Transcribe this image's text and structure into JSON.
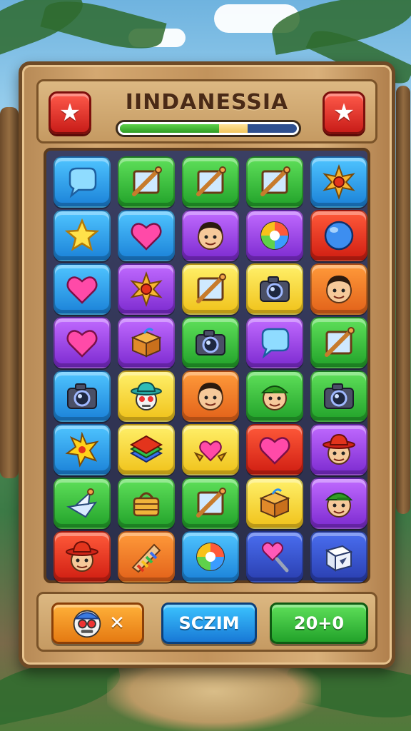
{
  "header": {
    "title": "IINDANESSIA",
    "left_icon": "star-icon",
    "right_icon": "star-icon",
    "progress": {
      "green_fraction": 0.56,
      "yellow_fraction": 0.16,
      "navy_fraction": 0.28,
      "colors": {
        "green": "#3fb22e",
        "yellow": "#f2c45c",
        "navy": "#2f4f8f"
      }
    }
  },
  "board": {
    "rows": 8,
    "cols": 5,
    "tiles": [
      [
        {
          "color": "blue",
          "icon": "chat-bubble-icon"
        },
        {
          "color": "green",
          "icon": "ruler-frame-icon"
        },
        {
          "color": "green",
          "icon": "ruler-frame-icon"
        },
        {
          "color": "green",
          "icon": "ruler-frame-icon"
        },
        {
          "color": "blue",
          "icon": "sun-gem-icon"
        }
      ],
      [
        {
          "color": "blue",
          "icon": "star-icon"
        },
        {
          "color": "blue",
          "icon": "heart-icon"
        },
        {
          "color": "purple",
          "icon": "face-icon"
        },
        {
          "color": "purple",
          "icon": "swirl-orb-icon"
        },
        {
          "color": "red",
          "icon": "orb-icon"
        }
      ],
      [
        {
          "color": "blue",
          "icon": "heart-icon"
        },
        {
          "color": "purple",
          "icon": "sun-gem-icon"
        },
        {
          "color": "yellow",
          "icon": "ruler-frame-icon"
        },
        {
          "color": "yellow",
          "icon": "camera-icon"
        },
        {
          "color": "orange",
          "icon": "face-icon"
        }
      ],
      [
        {
          "color": "purple",
          "icon": "heart-icon"
        },
        {
          "color": "purple",
          "icon": "box-icon"
        },
        {
          "color": "green",
          "icon": "camera-icon"
        },
        {
          "color": "purple",
          "icon": "chat-bubble-icon"
        },
        {
          "color": "green",
          "icon": "ruler-frame-icon"
        }
      ],
      [
        {
          "color": "blue",
          "icon": "camera-icon"
        },
        {
          "color": "yellow",
          "icon": "robot-hat-icon"
        },
        {
          "color": "orange",
          "icon": "face-icon"
        },
        {
          "color": "green",
          "icon": "face-cap-icon"
        },
        {
          "color": "green",
          "icon": "camera-icon"
        }
      ],
      [
        {
          "color": "blue",
          "icon": "star-burst-icon"
        },
        {
          "color": "yellow",
          "icon": "layers-icon"
        },
        {
          "color": "yellow",
          "icon": "heart-wing-icon"
        },
        {
          "color": "red",
          "icon": "heart-icon"
        },
        {
          "color": "purple",
          "icon": "face-hat-icon"
        }
      ],
      [
        {
          "color": "green",
          "icon": "paper-boat-icon"
        },
        {
          "color": "green",
          "icon": "basket-icon"
        },
        {
          "color": "green",
          "icon": "ruler-frame-icon"
        },
        {
          "color": "yellow",
          "icon": "box-icon"
        },
        {
          "color": "purple",
          "icon": "face-cap-icon"
        }
      ],
      [
        {
          "color": "red",
          "icon": "face-hat-icon"
        },
        {
          "color": "orange",
          "icon": "xylophone-icon"
        },
        {
          "color": "blue",
          "icon": "swirl-orb-icon"
        },
        {
          "color": "navy",
          "icon": "heart-wand-icon"
        },
        {
          "color": "navy",
          "icon": "cube-icon"
        }
      ]
    ],
    "colors": {
      "blue": "#2a9cf0",
      "green": "#33b533",
      "purple": "#9a45e6",
      "red": "#e63a22",
      "yellow": "#f7d93a",
      "orange": "#f17a24",
      "navy": "#3450d0"
    }
  },
  "footer": {
    "powerup_button": {
      "icon": "robot-face-icon",
      "label": "✕"
    },
    "scan_button": {
      "label": "SCZIM"
    },
    "score_button": {
      "label": "20+0"
    }
  }
}
